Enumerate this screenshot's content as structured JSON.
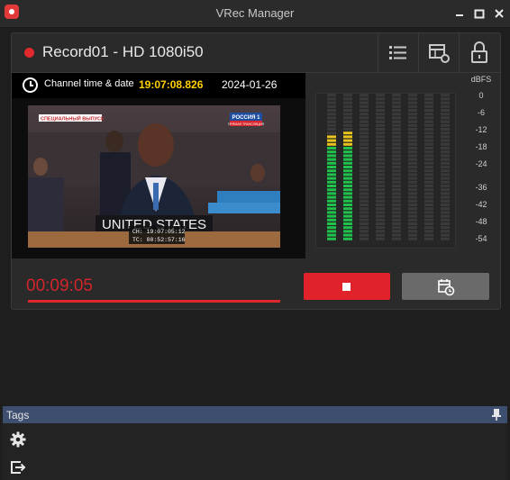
{
  "window": {
    "title": "VRec Manager"
  },
  "recorder": {
    "name": "Record01 - HD 1080i50",
    "channel_label": "Channel time & date",
    "channel_time": "19:07:08.826",
    "channel_date": "2024-01-26",
    "elapsed": "00:09:05"
  },
  "video": {
    "banner": "СПЕЦИАЛЬНЫЙ ВЫПУСК",
    "channel_logo_line1": "РОССИЯ 1",
    "channel_logo_line2": "ПРЯМАЯ ТРАНСЛЯЦИЯ",
    "nameplate": "UNITED STATES",
    "ch_timecode": "CH: 19:07:05:12",
    "tc_timecode": "TC: 00:52:57:16"
  },
  "meter": {
    "unit": "dBFS",
    "scale": [
      "0",
      "-6",
      "-12",
      "-18",
      "-24",
      "-36",
      "-42",
      "-48",
      "-54"
    ],
    "left_level_fraction": 0.72,
    "right_level_fraction": 0.74,
    "colors": {
      "green": "#1fc24a",
      "yellow": "#e7c51d",
      "idle": "#3a3a3a"
    }
  },
  "tags": {
    "title": "Tags"
  },
  "colors": {
    "accent_red": "#e0232a",
    "tags_bar": "#3d4e6e"
  }
}
